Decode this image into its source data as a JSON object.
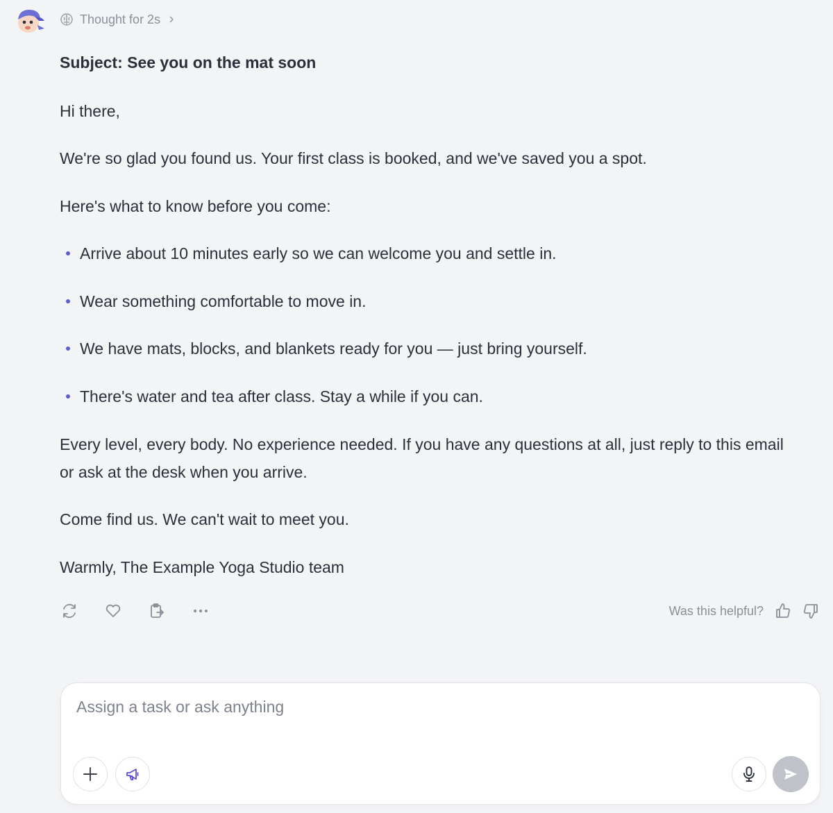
{
  "header": {
    "thought_label": "Thought for 2s",
    "avatar_icon": "cartoon-avatar-icon",
    "brain_icon": "brain-icon",
    "chevron_icon": "chevron-right-icon"
  },
  "message": {
    "subject": "Subject: See you on the mat soon",
    "greeting": "Hi there,",
    "intro": "We're so glad you found us. Your first class is booked, and we've saved you a spot.",
    "lead_in": "Here's what to know before you come:",
    "bullets": [
      "Arrive about 10 minutes early so we can welcome you and settle in.",
      "Wear something comfortable to move in.",
      "We have mats, blocks, and blankets ready for you — just bring yourself.",
      "There's water and tea after class. Stay a while if you can."
    ],
    "levels": "Every level, every body. No experience needed. If you have any questions at all, just reply to this email or ask at the desk when you arrive.",
    "closing": "Come find us. We can't wait to meet you.",
    "signoff": "Warmly, The Example Yoga Studio team"
  },
  "actions": {
    "icons": [
      "regenerate-icon",
      "heart-icon",
      "copy-icon",
      "more-icon"
    ],
    "feedback_label": "Was this helpful?",
    "feedback_icons": [
      "thumbs-up-icon",
      "thumbs-down-icon"
    ]
  },
  "composer": {
    "placeholder": "Assign a task or ask anything",
    "value": "",
    "icons": [
      "plus-icon",
      "megaphone-icon",
      "microphone-icon",
      "send-icon"
    ]
  },
  "colors": {
    "background": "#f3f4f6",
    "text": "#2b2f3a",
    "muted": "#8a8f99",
    "bullet": "#5b5fc7",
    "accent_icon": "#5b4fd6",
    "send_disabled": "#bfc2c8"
  }
}
